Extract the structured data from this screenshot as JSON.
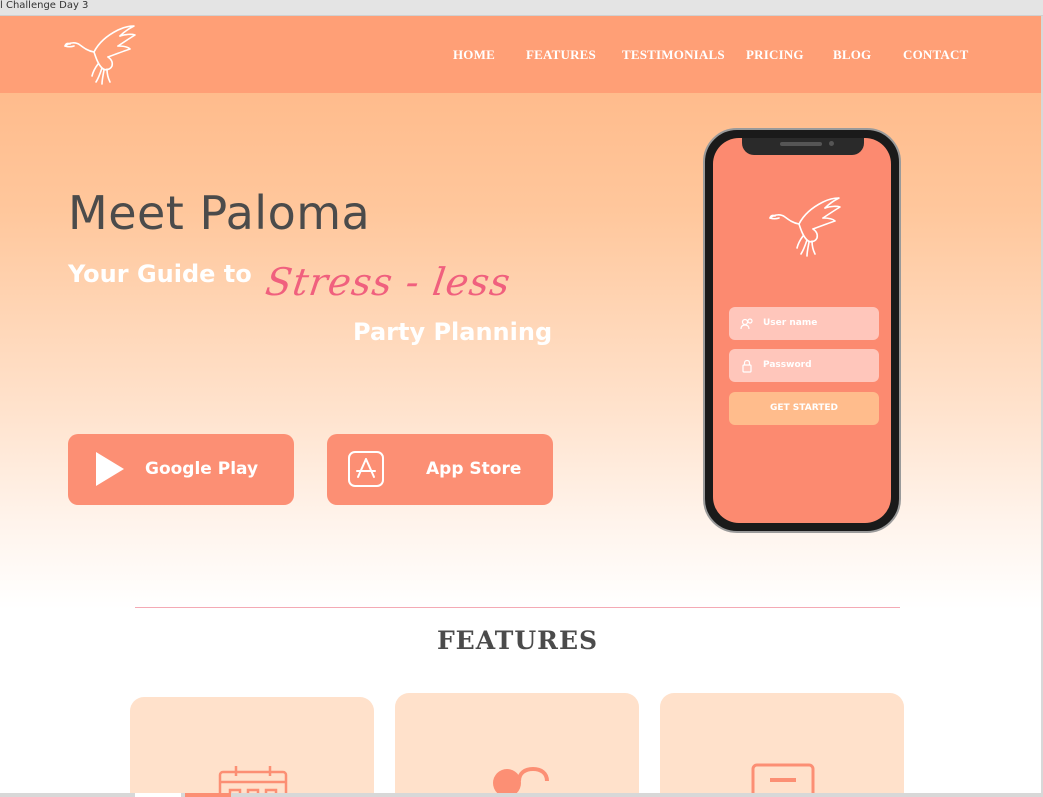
{
  "browser": {
    "tab_title": "l Challenge Day 3"
  },
  "nav": {
    "items": [
      {
        "label": "HOME"
      },
      {
        "label": "FEATURES"
      },
      {
        "label": "TESTIMONIALS"
      },
      {
        "label": "PRICING"
      },
      {
        "label": "BLOG"
      },
      {
        "label": "CONTACT"
      }
    ]
  },
  "hero": {
    "title": "Meet Paloma",
    "subtitle_part1": "Your Guide to",
    "subtitle_script": "Stress - less",
    "subtitle_part2": "Party Planning"
  },
  "store_buttons": {
    "google_play": "Google Play",
    "app_store": "App Store"
  },
  "phone": {
    "username_placeholder": "User name",
    "password_placeholder": "Password",
    "cta_label": "GET STARTED"
  },
  "features": {
    "heading": "FEATURES"
  },
  "icons": {
    "logo": "dove-icon",
    "google_play": "play-icon",
    "app_store": "app-store-icon",
    "username": "user-icon",
    "password": "lock-icon",
    "feature_1": "calendar-icon",
    "feature_2": "people-icon",
    "feature_3": "list-icon"
  },
  "colors": {
    "navbar": "#ff9f76",
    "accent_coral": "#fc8f74",
    "accent_pink": "#f0607e",
    "heading_gray": "#4b4b4b",
    "card_bg": "#ffe1cb",
    "cta_orange": "#ffbc8c"
  }
}
